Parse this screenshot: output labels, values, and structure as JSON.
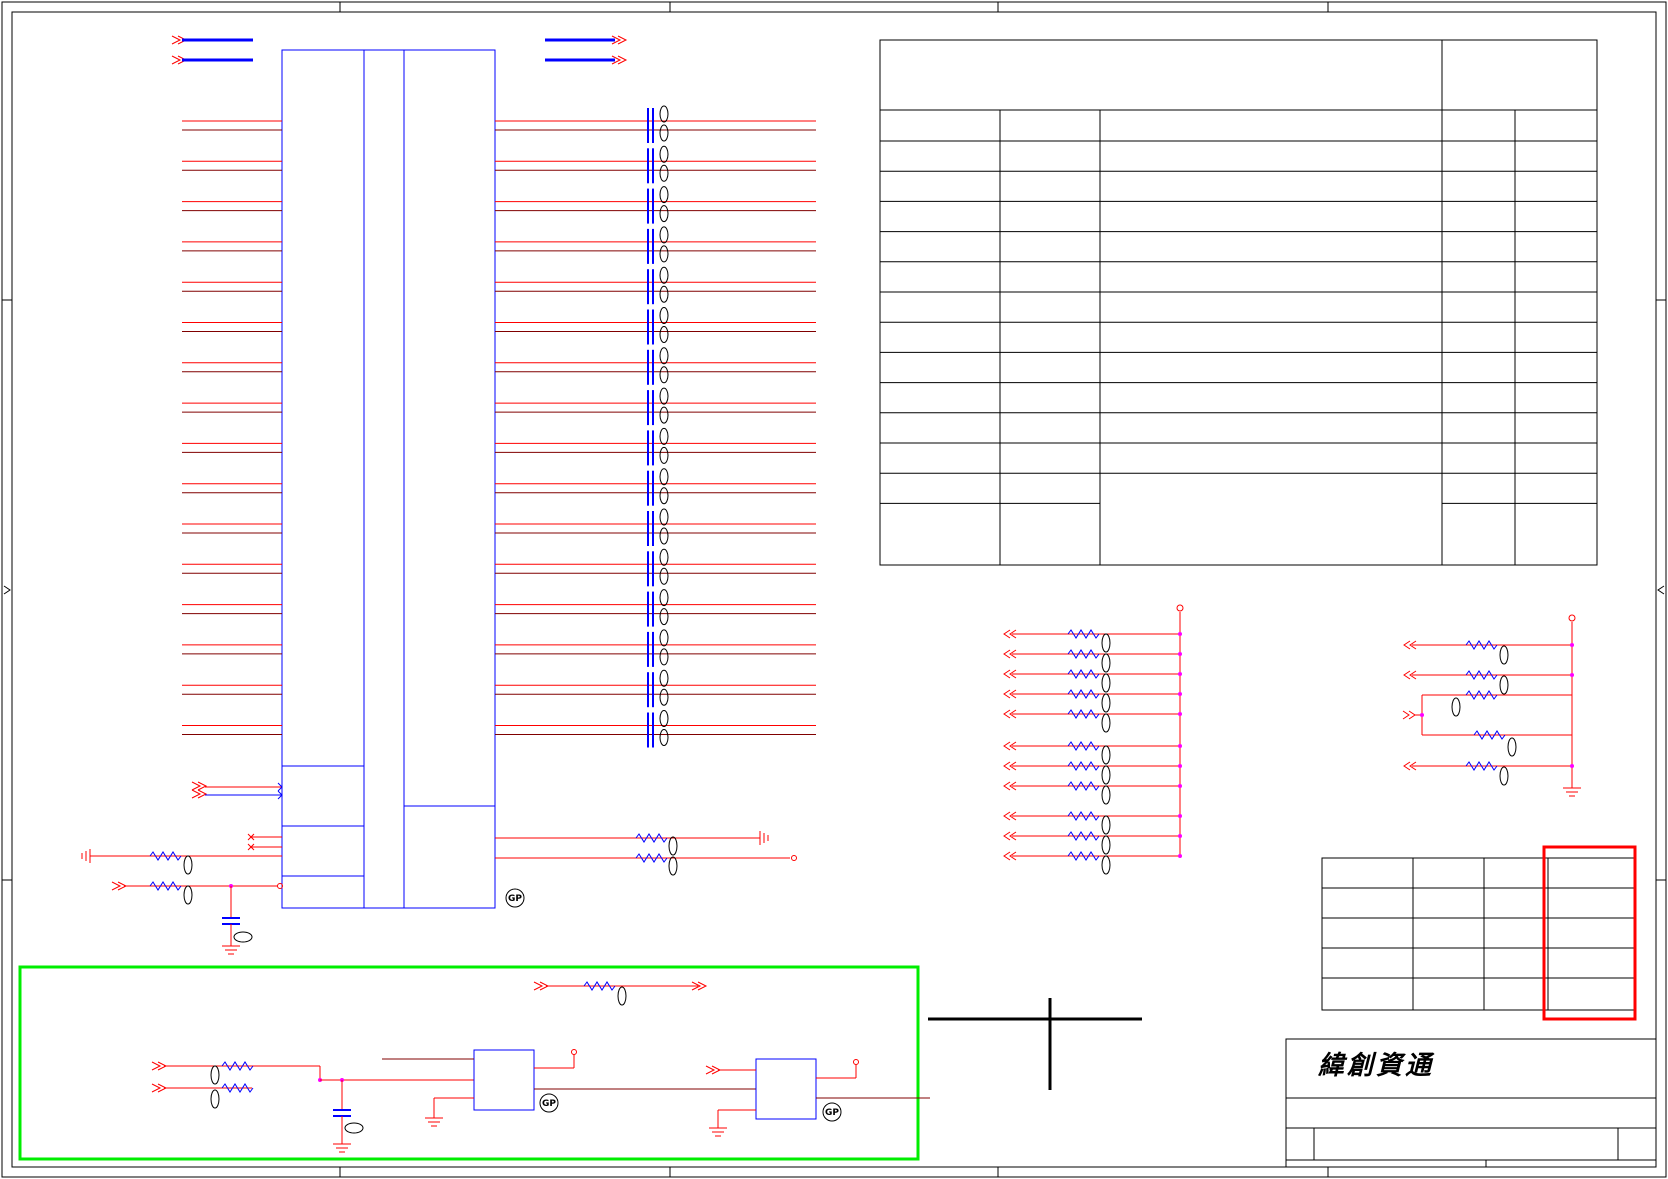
{
  "company": {
    "name": "緯創資通"
  },
  "badges": {
    "gp": "GP"
  },
  "colors": {
    "wire": "#ff0000",
    "component": "#0000ff",
    "highlight_green": "#00ee00",
    "highlight_red": "#ff0000",
    "frame": "#000000",
    "junction": "#ff00ff",
    "net_blue": "#0000ff",
    "net_dark": "#800000"
  }
}
